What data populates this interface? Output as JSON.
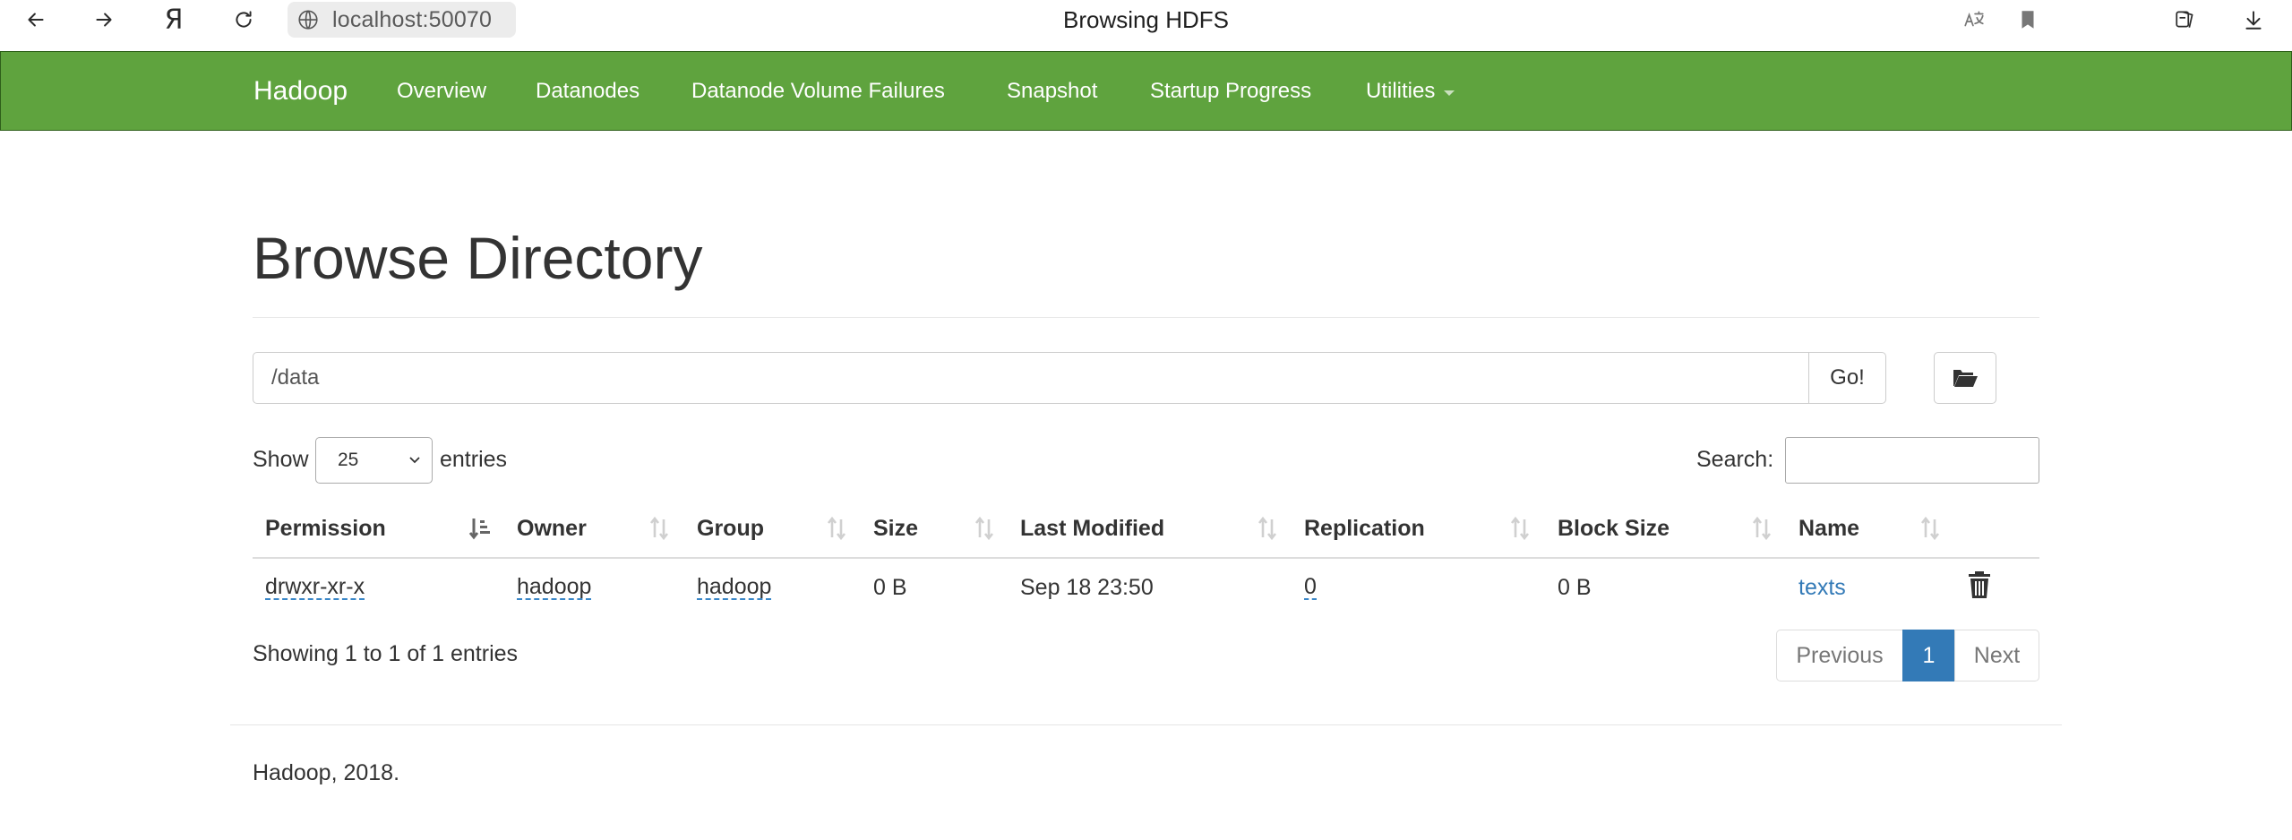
{
  "browser": {
    "url": "localhost:50070",
    "tab_title": "Browsing HDFS"
  },
  "navbar": {
    "brand": "Hadoop",
    "items": [
      {
        "label": "Overview"
      },
      {
        "label": "Datanodes"
      },
      {
        "label": "Datanode Volume Failures"
      },
      {
        "label": "Snapshot"
      },
      {
        "label": "Startup Progress"
      },
      {
        "label": "Utilities"
      }
    ],
    "color": "#5fa33e"
  },
  "main": {
    "title": "Browse Directory",
    "directory_value": "/data",
    "go_label": "Go!",
    "show_label": "Show",
    "entries_label": "entries",
    "page_length": "25",
    "search_label": "Search:",
    "search_value": ""
  },
  "table": {
    "columns": [
      "Permission",
      "Owner",
      "Group",
      "Size",
      "Last Modified",
      "Replication",
      "Block Size",
      "Name"
    ],
    "rows": [
      {
        "permission": "drwxr-xr-x",
        "owner": "hadoop",
        "group": "hadoop",
        "size": "0 B",
        "last_modified": "Sep 18 23:50",
        "replication": "0",
        "block_size": "0 B",
        "name": "texts"
      }
    ],
    "info": "Showing 1 to 1 of 1 entries",
    "pagination": {
      "previous": "Previous",
      "current": "1",
      "next": "Next"
    },
    "link_color": "#337ab7"
  },
  "footer": {
    "text": "Hadoop, 2018."
  }
}
